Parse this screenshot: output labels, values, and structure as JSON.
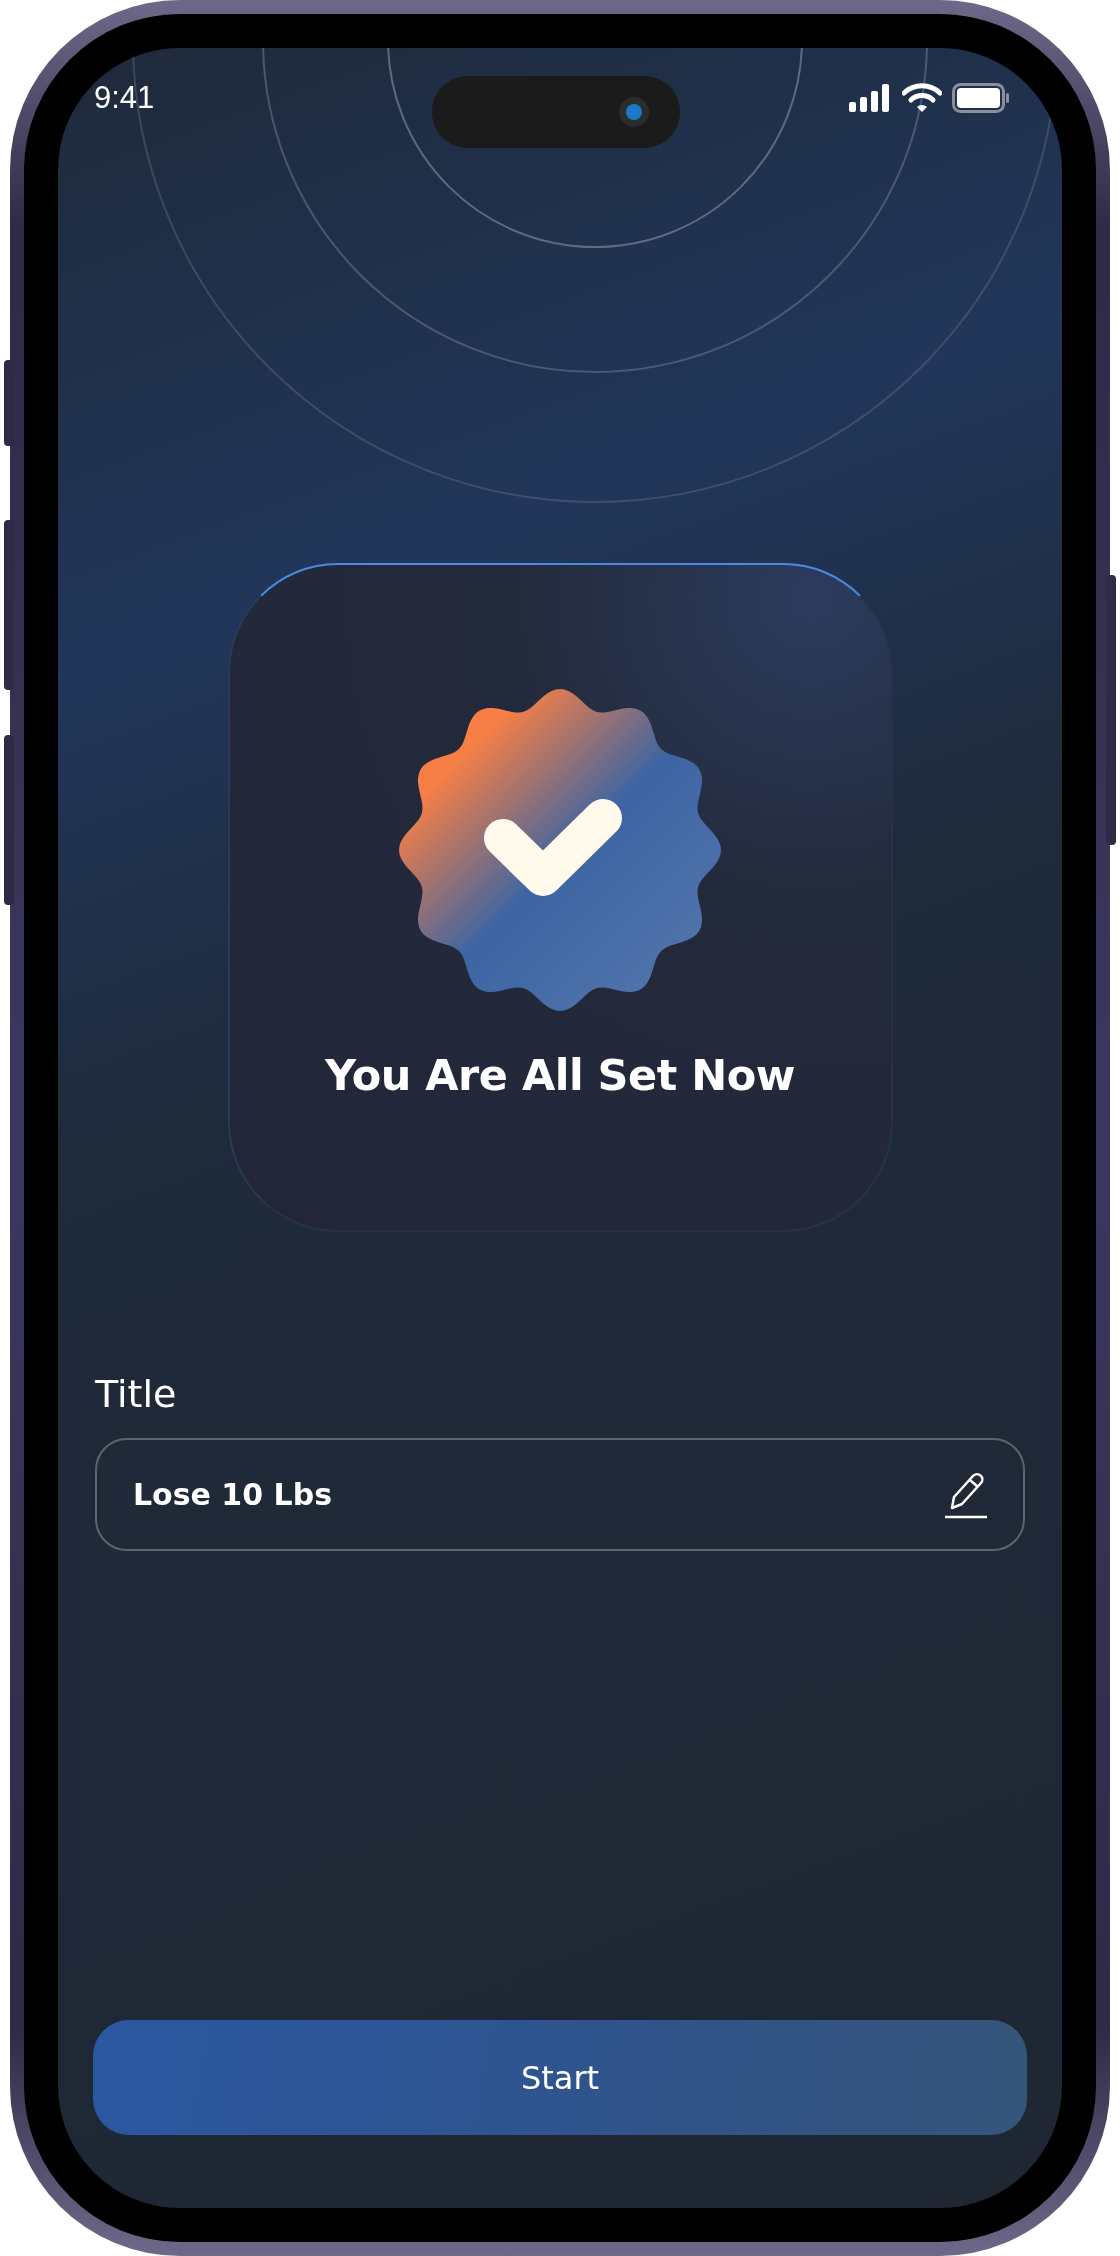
{
  "status_bar": {
    "time": "9:41"
  },
  "card": {
    "title": "You Are All Set Now"
  },
  "title_field": {
    "label": "Title",
    "value": "Lose 10 Lbs"
  },
  "start_button": {
    "label": "Start"
  }
}
